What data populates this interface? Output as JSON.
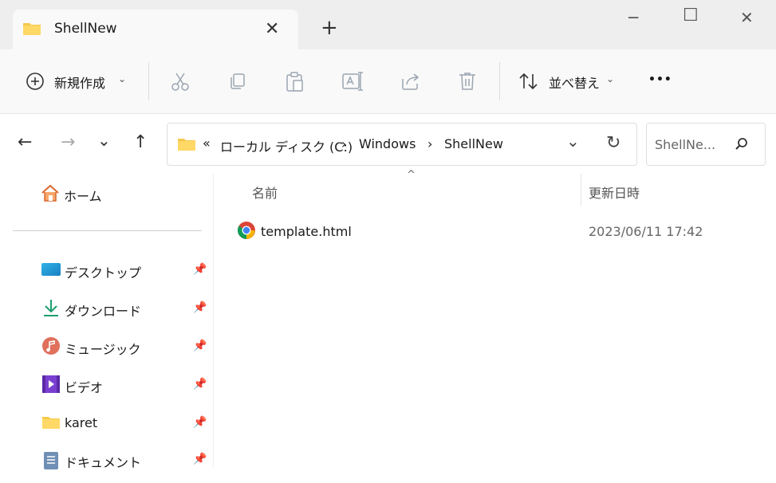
{
  "window": {
    "tab_title": "ShellNew",
    "new_tab_label": "+",
    "minimize_glyph": "─",
    "maximize_glyph": "☐",
    "close_glyph": "✕",
    "tab_close_glyph": "✕"
  },
  "toolbar": {
    "new_label": "新規作成",
    "sort_label": "並べ替え",
    "more_label": "•••",
    "icons": [
      "cut-icon",
      "copy-icon",
      "paste-icon",
      "rename-icon",
      "share-icon",
      "delete-icon"
    ]
  },
  "address": {
    "overflow": "«",
    "crumbs": [
      "ローカル ディスク (C:)",
      "Windows",
      "ShellNew"
    ],
    "sep": "›"
  },
  "search": {
    "placeholder": "ShellNe..."
  },
  "sidebar": {
    "home": "ホーム",
    "items": [
      {
        "label": "デスクトップ",
        "icon": "desktop-icon"
      },
      {
        "label": "ダウンロード",
        "icon": "download-icon"
      },
      {
        "label": "ミュージック",
        "icon": "music-icon"
      },
      {
        "label": "ビデオ",
        "icon": "video-icon"
      },
      {
        "label": "karet",
        "icon": "folder-icon"
      },
      {
        "label": "ドキュメント",
        "icon": "document-icon"
      }
    ]
  },
  "list": {
    "columns": {
      "name": "名前",
      "modified": "更新日時"
    },
    "rows": [
      {
        "name": "template.html",
        "modified": "2023/06/11 17:42",
        "icon": "chrome-icon"
      }
    ]
  },
  "colors": {
    "folder": "#f5c84c",
    "accent": "#0067c0"
  }
}
